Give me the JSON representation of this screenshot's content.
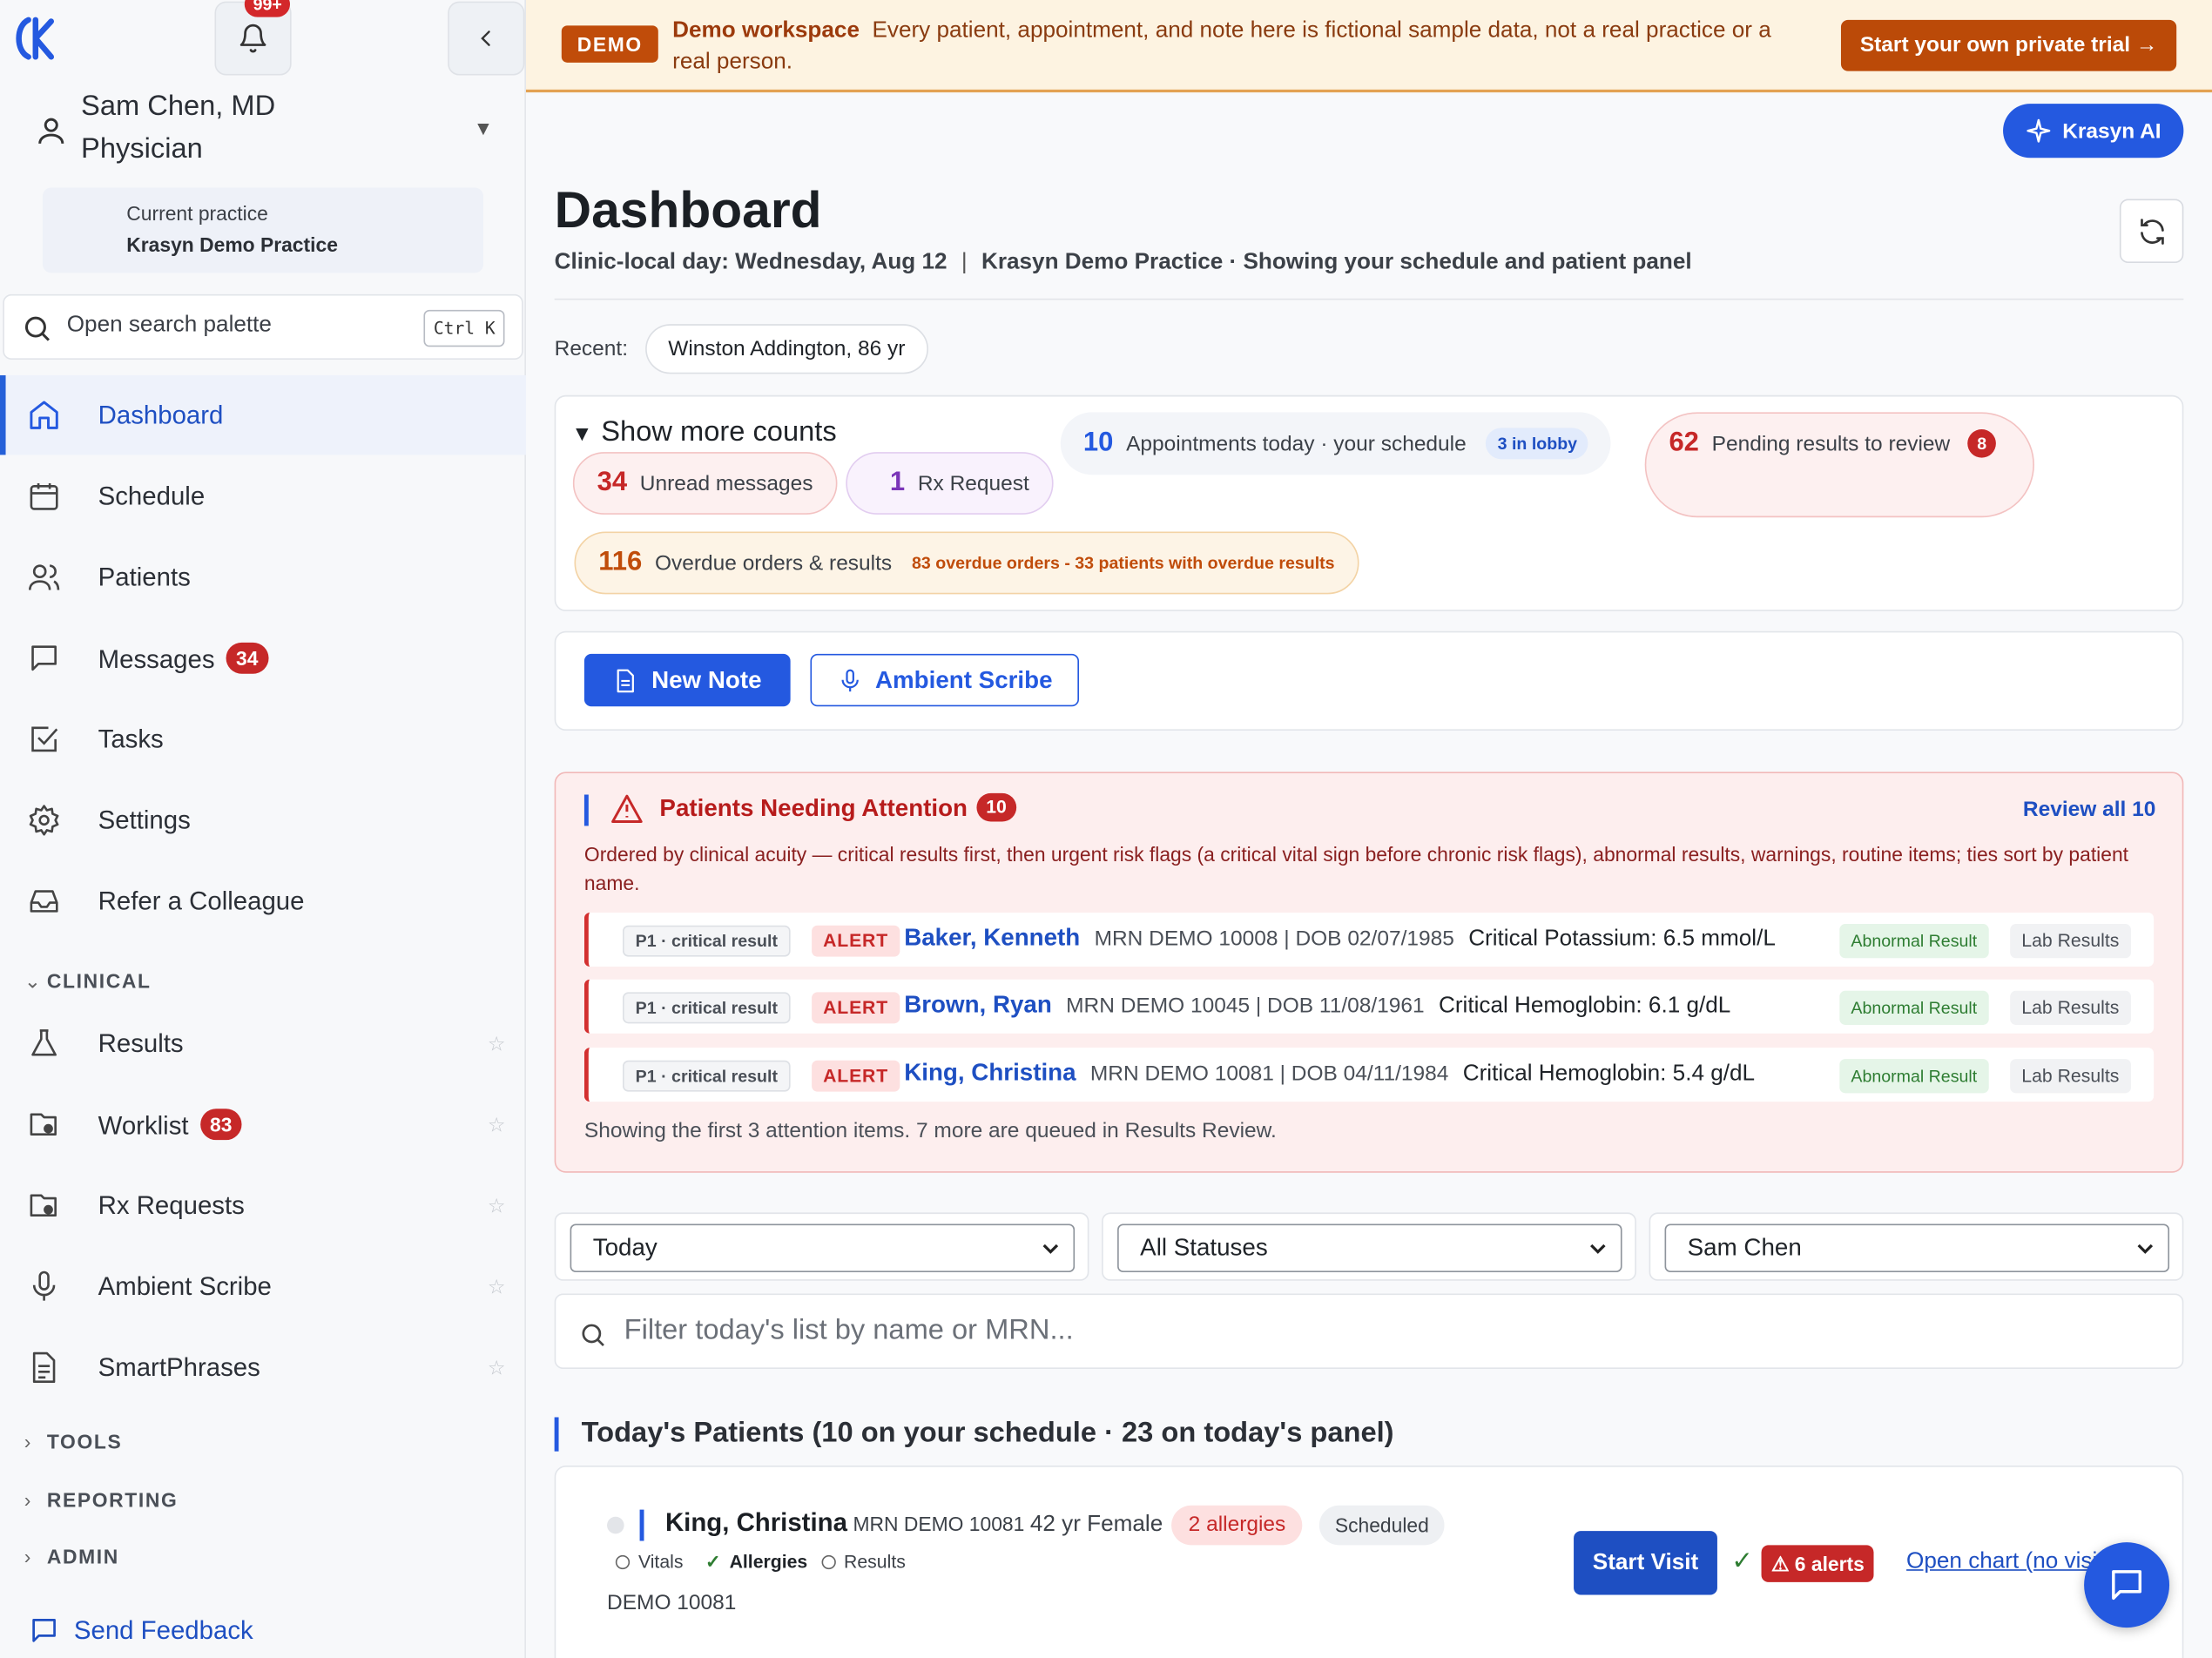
{
  "sidebar": {
    "notifications_badge": "99+",
    "user": {
      "name": "Sam Chen, MD",
      "role": "Physician"
    },
    "practice": {
      "label": "Current practice",
      "name": "Krasyn Demo Practice"
    },
    "search": {
      "label": "Open search palette",
      "shortcut": "Ctrl K"
    },
    "nav": [
      {
        "label": "Dashboard",
        "icon": "home-icon",
        "active": true
      },
      {
        "label": "Schedule",
        "icon": "calendar-icon"
      },
      {
        "label": "Patients",
        "icon": "users-icon"
      },
      {
        "label": "Messages",
        "icon": "message-icon",
        "badge": "34"
      },
      {
        "label": "Tasks",
        "icon": "checkbox-icon"
      },
      {
        "label": "Settings",
        "icon": "gear-icon"
      },
      {
        "label": "Refer a Colleague",
        "icon": "inbox-icon"
      }
    ],
    "sections": {
      "clinical": "CLINICAL",
      "tools": "TOOLS",
      "reporting": "REPORTING",
      "admin": "ADMIN"
    },
    "clinical_items": [
      {
        "label": "Results",
        "icon": "flask-icon"
      },
      {
        "label": "Worklist",
        "icon": "folder-icon",
        "badge": "83"
      },
      {
        "label": "Rx Requests",
        "icon": "folder-icon"
      },
      {
        "label": "Ambient Scribe",
        "icon": "microphone-icon"
      },
      {
        "label": "SmartPhrases",
        "icon": "document-icon"
      }
    ],
    "feedback": "Send Feedback"
  },
  "banner": {
    "pill": "DEMO",
    "title": "Demo workspace",
    "text": "Every patient, appointment, and note here is fictional sample data, not a real practice or a real person.",
    "cta": "Start your own private trial →"
  },
  "header": {
    "ai_button": "Krasyn AI",
    "title": "Dashboard",
    "clinic_day": "Clinic-local day: Wednesday, Aug 12",
    "separator": "|",
    "practice_note": "Krasyn Demo Practice · Showing your schedule and patient panel",
    "recent_label": "Recent:",
    "recent_chip": "Winston Addington, 86 yr"
  },
  "counts": {
    "toggle": "Show more counts",
    "unread": {
      "num": "34",
      "label": "Unread messages"
    },
    "rx": {
      "num": "1",
      "label": "Rx Request"
    },
    "appointments": {
      "num": "10",
      "label": "Appointments today · your schedule",
      "badge": "3 in lobby"
    },
    "pending": {
      "num": "62",
      "label": "Pending results to review",
      "badge": "8"
    },
    "overdue": {
      "num": "116",
      "label": "Overdue orders & results",
      "detail": "83 overdue orders - 33 patients with overdue results"
    }
  },
  "actions": {
    "new_note": "New Note",
    "ambient_scribe": "Ambient Scribe"
  },
  "attention": {
    "title": "Patients Needing Attention",
    "badge": "10",
    "review_all": "Review all 10",
    "description": "Ordered by clinical acuity — critical results first, then urgent risk flags (a critical vital sign before chronic risk flags), abnormal results, warnings, routine items; ties sort by patient name.",
    "rows": [
      {
        "priority": "P1 · critical result",
        "flag": "ALERT",
        "name": "Baker, Kenneth",
        "mrn": "MRN DEMO 10008 | DOB 02/07/1985",
        "finding": "Critical Potassium: 6.5 mmol/L",
        "type": "Abnormal Result",
        "category": "Lab Results"
      },
      {
        "priority": "P1 · critical result",
        "flag": "ALERT",
        "name": "Brown, Ryan",
        "mrn": "MRN DEMO 10045 | DOB 11/08/1961",
        "finding": "Critical Hemoglobin: 6.1 g/dL",
        "type": "Abnormal Result",
        "category": "Lab Results"
      },
      {
        "priority": "P1 · critical result",
        "flag": "ALERT",
        "name": "King, Christina",
        "mrn": "MRN DEMO 10081 | DOB 04/11/1984",
        "finding": "Critical Hemoglobin: 5.4 g/dL",
        "type": "Abnormal Result",
        "category": "Lab Results"
      }
    ],
    "footer": "Showing the first 3 attention items. 7 more are queued in Results Review."
  },
  "filters": {
    "date": "Today",
    "status": "All Statuses",
    "provider": "Sam Chen",
    "search_placeholder": "Filter today's list by name or MRN..."
  },
  "todays_patients": {
    "title": "Today's Patients (10 on your schedule · 23 on today's panel)",
    "patient": {
      "name": "King, Christina",
      "mrn": "MRN DEMO 10081",
      "demo": "42 yr Female",
      "allergies": "2 allergies",
      "status": "Scheduled",
      "vitals": "Vitals",
      "allergy_check": "Allergies",
      "results": "Results",
      "sub": "DEMO 10081",
      "start_visit": "Start Visit",
      "check": "✓",
      "alerts": "⚠ 6 alerts",
      "open_chart": "Open chart (no visit)"
    }
  },
  "colors": {
    "primary": "#2459e0",
    "alert": "#c62828",
    "banner": "#fdf3e1",
    "attention_bg": "#fdeeee"
  }
}
